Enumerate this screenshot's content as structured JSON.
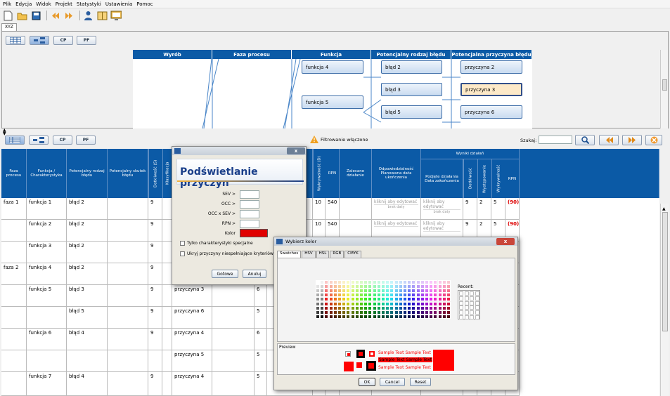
{
  "menu": [
    "Plik",
    "Edycja",
    "Widok",
    "Projekt",
    "Statystyki",
    "Ustawienia",
    "Pomoc"
  ],
  "doc_tab": "XYZ",
  "view_buttons": [
    "",
    "",
    "CP",
    "PF"
  ],
  "diagram": {
    "headers": [
      "Wyrób",
      "Faza procesu",
      "Funkcja",
      "Potencjalny rodzaj błędu",
      "Potencjalna przyczyna błędu"
    ],
    "functions": [
      "funkcja 4",
      "funkcja 5"
    ],
    "errors": [
      "błąd 2",
      "błąd 3",
      "błąd 5"
    ],
    "causes": [
      "przyczyna 2",
      "przyczyna 3",
      "przyczyna 6"
    ]
  },
  "toolbar2": {
    "filter_text": "Filtrowanie włączone",
    "search_label": "Szukaj:",
    "search_value": ""
  },
  "table": {
    "headers": {
      "faza": "Faza procesu",
      "funkcja": "Funkcja / Charakterystyka",
      "blad": "Potencjalny rodzaj błędu",
      "skutek": "Potencjalny skutek błędu",
      "dotkliwosc": "Dotkliwość (S)",
      "klasyfikacja": "Klasyfikacja",
      "wykrywalnosc": "Wykrywalność (D)",
      "rpn": "RPN",
      "zalecane": "Zalecane działanie",
      "odpowiedzialnosc": "Odpowiedzialność Planowana data ukończenia",
      "wyniki": "Wyniki działań",
      "podjete": "Podjęte działania Data zakończenia",
      "w_dotkliwosc": "Dotkliwość",
      "w_wystepowanie": "Występowanie",
      "w_wykrywalnosc": "Wykrywalność",
      "w_rpn": "RPN"
    },
    "rows": [
      {
        "faza": "faza 1",
        "funkcja": "funkcja 1",
        "blad": "błąd 2",
        "s": "9",
        "przyczyna": "",
        "o": "",
        "d": "10",
        "rpn": "540",
        "click1": "kliknij aby edytować",
        "nodate1": "brak daty",
        "click2": "kliknij aby edytować",
        "nodate2": "brak daty",
        "ws": "9",
        "wo": "2",
        "wd": "5",
        "wrpn": "(90)"
      },
      {
        "faza": "",
        "funkcja": "funkcja 2",
        "blad": "błąd 2",
        "s": "9",
        "przyczyna": "",
        "o": "",
        "d": "10",
        "rpn": "540",
        "click1": "kliknij aby edytować",
        "nodate1": "",
        "click2": "kliknij aby edytować",
        "nodate2": "",
        "ws": "9",
        "wo": "2",
        "wd": "5",
        "wrpn": "(90)"
      },
      {
        "faza": "",
        "funkcja": "funkcja 3",
        "blad": "błąd 2",
        "s": "9",
        "przyczyna": "",
        "o": "",
        "d": "",
        "rpn": "",
        "click1": "",
        "nodate1": "",
        "click2": "",
        "nodate2": "",
        "ws": "",
        "wo": "",
        "wd": "",
        "wrpn": ""
      },
      {
        "faza": "faza 2",
        "funkcja": "funkcja 4",
        "blad": "błąd 2",
        "s": "9",
        "przyczyna": "",
        "o": "",
        "d": "",
        "rpn": "",
        "click1": "",
        "nodate1": "",
        "click2": "",
        "nodate2": "",
        "ws": "",
        "wo": "",
        "wd": "",
        "wrpn": ""
      },
      {
        "faza": "",
        "funkcja": "funkcja 5",
        "blad": "błąd 3",
        "s": "9",
        "przyczyna": "przyczyna 3",
        "o": "6",
        "d": "",
        "rpn": "",
        "click1": "",
        "nodate1": "",
        "click2": "",
        "nodate2": "",
        "ws": "",
        "wo": "",
        "wd": "",
        "wrpn": ""
      },
      {
        "faza": "",
        "funkcja": "",
        "blad": "błąd 5",
        "s": "9",
        "przyczyna": "przyczyna 6",
        "o": "5",
        "d": "",
        "rpn": "",
        "click1": "",
        "nodate1": "",
        "click2": "",
        "nodate2": "",
        "ws": "",
        "wo": "",
        "wd": "",
        "wrpn": ""
      },
      {
        "faza": "",
        "funkcja": "funkcja 6",
        "blad": "błąd 4",
        "s": "9",
        "przyczyna": "przyczyna 4",
        "o": "6",
        "d": "",
        "rpn": "",
        "click1": "",
        "nodate1": "",
        "click2": "",
        "nodate2": "",
        "ws": "",
        "wo": "",
        "wd": "",
        "wrpn": ""
      },
      {
        "faza": "",
        "funkcja": "",
        "blad": "",
        "s": "",
        "przyczyna": "przyczyna 5",
        "o": "5",
        "d": "",
        "rpn": "",
        "click1": "",
        "nodate1": "",
        "click2": "",
        "nodate2": "",
        "ws": "",
        "wo": "",
        "wd": "",
        "wrpn": ""
      },
      {
        "faza": "",
        "funkcja": "funkcja 7",
        "blad": "błąd 4",
        "s": "9",
        "przyczyna": "przyczyna 4",
        "o": "5",
        "d": "",
        "rpn": "",
        "click1": "",
        "nodate1": "",
        "click2": "",
        "nodate2": "",
        "ws": "",
        "wo": "",
        "wd": "",
        "wrpn": ""
      }
    ]
  },
  "highlight_dialog": {
    "close": "x",
    "title": "Podświetlanie przyczyn",
    "labels": [
      "SEV >",
      "OCC >",
      "OCC x SEV >",
      "RPN >",
      "Kolor"
    ],
    "color": "#e00000",
    "check1": "Tylko charakterystyki specjalne",
    "check2": "Ukryj przyczyny niespełniające kryteriów",
    "ok": "Gotowe",
    "cancel": "Anuluj"
  },
  "color_dialog": {
    "title": "Wybierz kolor",
    "close": "x",
    "tabs": [
      "Swatches",
      "HSV",
      "HSL",
      "RGB",
      "CMYK"
    ],
    "recent": "Recent:",
    "preview": "Preview",
    "sample": "Sample Text",
    "ok": "OK",
    "cancel": "Cancel",
    "reset": "Reset",
    "selected": "#ff0000"
  }
}
